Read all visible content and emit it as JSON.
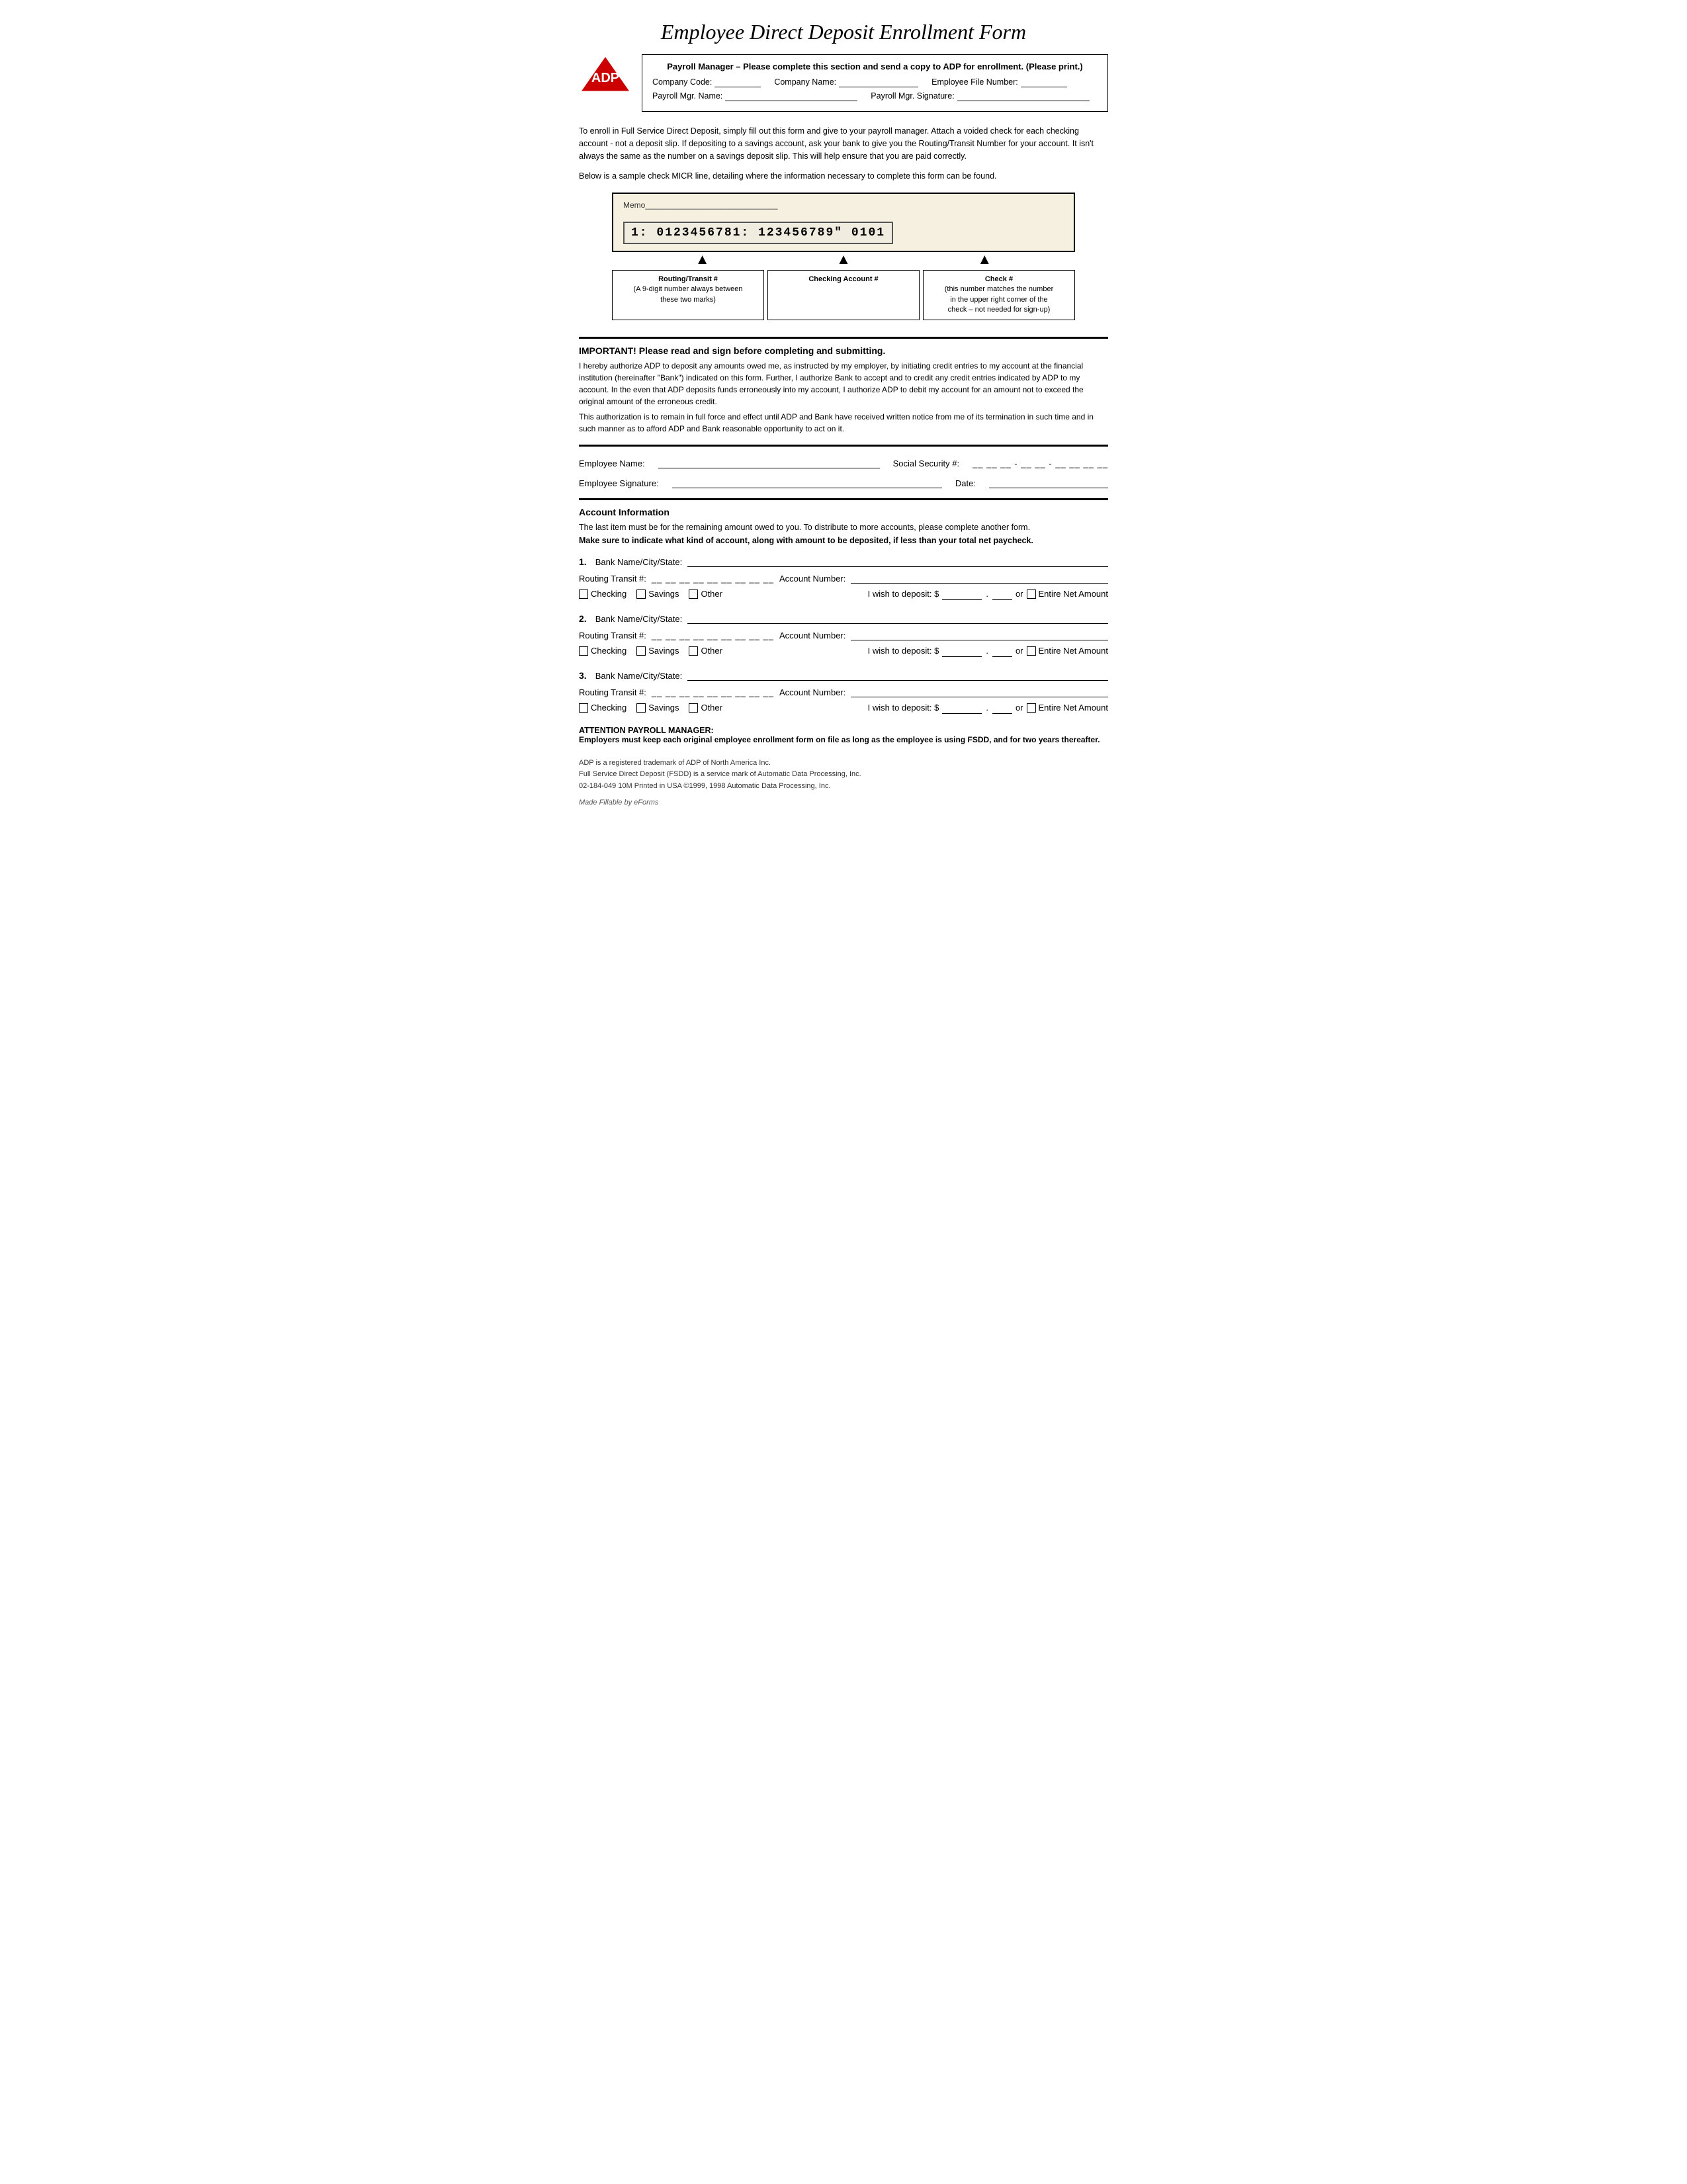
{
  "title": "Employee Direct Deposit Enrollment Form",
  "header": {
    "bold_line": "Payroll Manager – Please complete this section and send a copy to ADP for enrollment. (Please print.)",
    "company_code_label": "Company Code:",
    "company_name_label": "Company Name:",
    "employee_file_label": "Employee File Number:",
    "payroll_mgr_label": "Payroll Mgr. Name:",
    "payroll_sig_label": "Payroll Mgr. Signature:"
  },
  "intro": {
    "para1": "To enroll in Full Service Direct Deposit, simply fill out this form and give to your payroll manager.  Attach a voided check for each checking account - not a deposit slip. If depositing to a savings account, ask your bank to give you the Routing/Transit Number for your account.  It isn't always the same as the number on a savings deposit slip. This will help ensure that you are paid correctly.",
    "para2": "Below is a sample check MICR line, detailing where the information necessary to complete this form can be found."
  },
  "check_diagram": {
    "memo_label": "Memo",
    "micr_line": "1: 0123456781: 123456789\" 0101",
    "label_routing": "Routing/Transit #\n(A 9-digit number always between\nthese two marks)",
    "label_checking": "Checking Account #",
    "label_check_num": "Check #\n(this number matches the number\nin the upper right corner of the\ncheck – not needed for sign-up)"
  },
  "important": {
    "heading": "IMPORTANT! Please read and sign before completing and submitting.",
    "text1": "I hereby authorize ADP to deposit any amounts owed me, as instructed by my employer, by initiating credit entries to my account at the financial institution (hereinafter \"Bank\") indicated on this form.  Further, I authorize Bank to accept and to credit any credit entries indicated by ADP to my account. In the even that ADP deposits funds erroneously into my account, I authorize ADP to debit my account for an amount not to exceed the original amount of the erroneous credit.",
    "text2": "    This authorization is to remain in full force and effect until ADP and Bank have received written notice from me of its termination in such time and in such manner as to afford ADP and Bank reasonable opportunity to act on it."
  },
  "employee_fields": {
    "name_label": "Employee Name:",
    "ssn_label": "Social Security #:",
    "ssn_pattern": "__ __ __ - __ __ - __ __ __ __",
    "sig_label": "Employee Signature:",
    "date_label": "Date:"
  },
  "account_section": {
    "heading": "Account Information",
    "desc": "The last item must be for the remaining amount owed to you. To distribute to more accounts, please complete another form.",
    "bold_note": "Make sure to indicate what kind of account, along with amount to be deposited, if less than your total net paycheck.",
    "entries": [
      {
        "num": "1.",
        "bank_label": "Bank Name/City/State:",
        "routing_label": "Routing Transit #:",
        "routing_pattern": "__ __ __ __ __ __ __ __ __",
        "account_label": "Account Number:",
        "check_label": "Checking",
        "savings_label": "Savings",
        "other_label": "Other",
        "deposit_label": "I wish to deposit: $",
        "or_label": "or",
        "entire_net_label": "Entire Net Amount"
      },
      {
        "num": "2.",
        "bank_label": "Bank Name/City/State:",
        "routing_label": "Routing Transit #:",
        "routing_pattern": "__ __ __ __ __ __ __ __ __",
        "account_label": "Account Number:",
        "check_label": "Checking",
        "savings_label": "Savings",
        "other_label": "Other",
        "deposit_label": "I wish to deposit: $",
        "or_label": "or",
        "entire_net_label": "Entire Net Amount"
      },
      {
        "num": "3.",
        "bank_label": "Bank Name/City/State:",
        "routing_label": "Routing Transit #:",
        "routing_pattern": "__ __ __ __ __ __ __ __ __",
        "account_label": "Account Number:",
        "check_label": "Checking",
        "savings_label": "Savings",
        "other_label": "Other",
        "deposit_label": "I wish to deposit: $",
        "or_label": "or",
        "entire_net_label": "Entire Net Amount"
      }
    ]
  },
  "attention": {
    "heading": "ATTENTION PAYROLL MANAGER:",
    "text": "Employers must keep each original employee enrollment form on file as long as the employee is using FSDD, and for two years thereafter."
  },
  "footer": {
    "line1": "ADP is a registered trademark of ADP of North America Inc.",
    "line2": "Full Service Direct Deposit (FSDD) is a service mark of Automatic Data Processing, Inc.",
    "line3": "02-184-049 10M Printed in USA ©1999, 1998 Automatic Data Processing, Inc.",
    "made_fillable": "Made Fillable by eForms"
  }
}
